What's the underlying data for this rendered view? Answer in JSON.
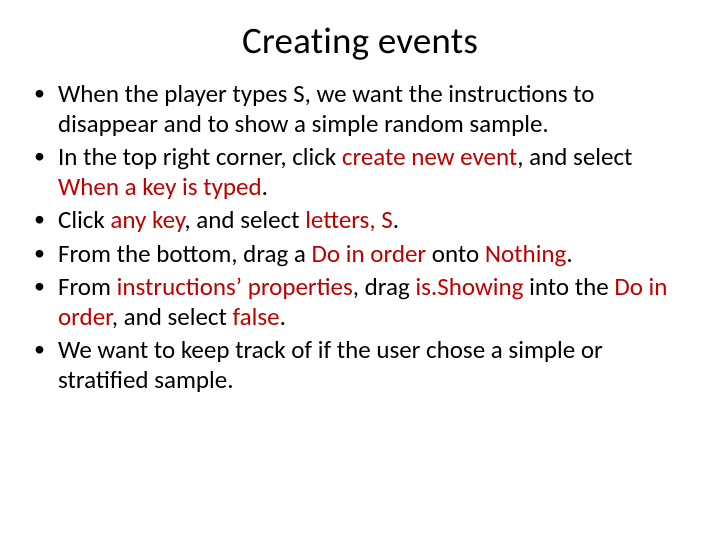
{
  "title": "Creating events",
  "bullets": {
    "b1": {
      "t1": "When the player types S, we want the instructions to disappear and to show a simple random sample."
    },
    "b2": {
      "t1": "In the top right corner, click ",
      "r1": "create new event",
      "t2": ", and select ",
      "r2": "When a key is typed",
      "t3": "."
    },
    "b3": {
      "t1": "Click ",
      "r1": "any key",
      "t2": ", and select ",
      "r2": "letters, S",
      "t3": "."
    },
    "b4": {
      "t1": "From the bottom, drag a ",
      "r1": "Do in order ",
      "t2": "onto ",
      "r2": "Nothing",
      "t3": "."
    },
    "b5": {
      "t1": "From ",
      "r1": "instructions’ properties",
      "t2": ", drag ",
      "r2": "is.Showing ",
      "t3": "into the ",
      "r3": "Do in order",
      "t4": ", and select ",
      "r4": "false",
      "t5": "."
    },
    "b6": {
      "t1": "We want to keep track of if the user chose a simple or stratified sample."
    }
  }
}
